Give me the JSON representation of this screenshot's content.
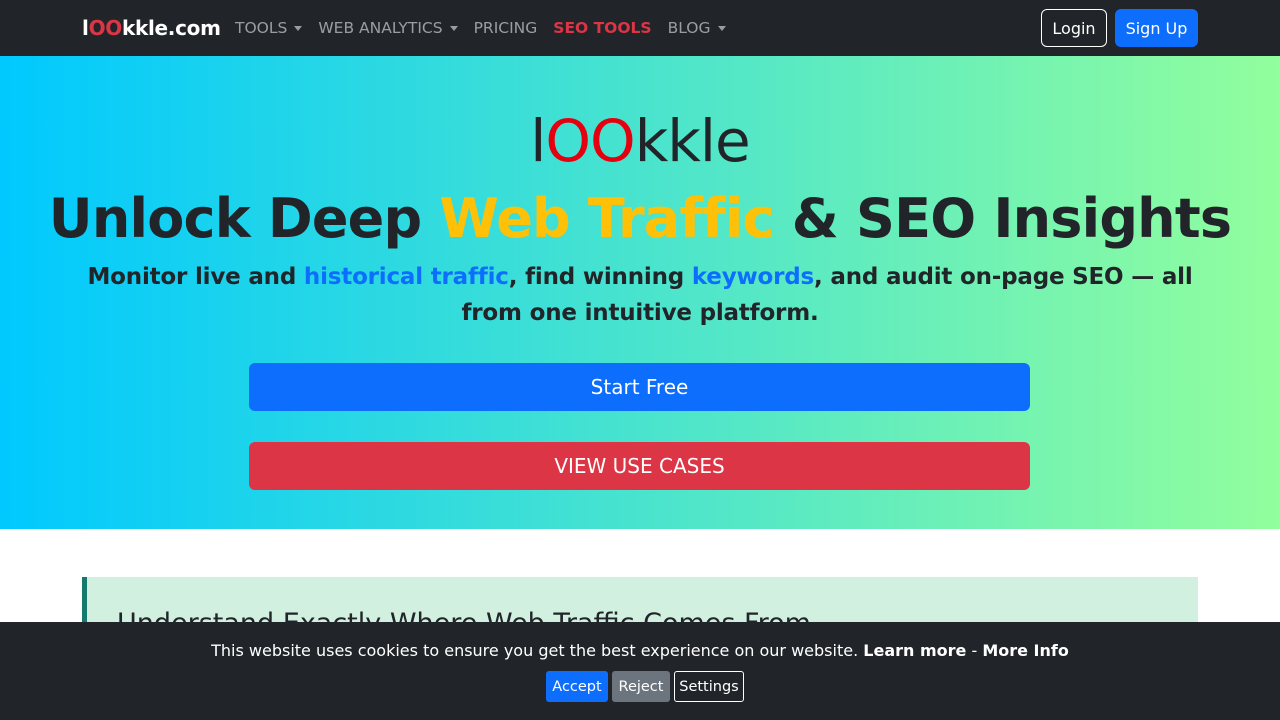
{
  "navbar": {
    "brand": {
      "prefix": "l",
      "highlight": "OO",
      "suffix": "kkle.com"
    },
    "items": [
      {
        "label": "TOOLS",
        "dropdown": true
      },
      {
        "label": "WEB ANALYTICS",
        "dropdown": true
      },
      {
        "label": "PRICING",
        "dropdown": false
      },
      {
        "label": "SEO TOOLS",
        "dropdown": false
      },
      {
        "label": "BLOG",
        "dropdown": true
      }
    ],
    "login_label": "Login",
    "signup_label": "Sign Up"
  },
  "hero": {
    "logo": {
      "prefix": "l",
      "highlight": "OO",
      "suffix": "kkle"
    },
    "headline": {
      "part1": "Unlock Deep ",
      "highlight": "Web Traffic",
      "part2": " & SEO Insights"
    },
    "subtitle": {
      "part1": "Monitor live and ",
      "link1": "historical traffic",
      "part2": ", find winning ",
      "link2": "keywords",
      "part3": ", and audit on-page SEO — all from one intuitive platform."
    },
    "start_label": "Start Free",
    "use_cases_label": "VIEW USE CASES"
  },
  "feature": {
    "title": "Understand Exactly Where Web Traffic Comes From"
  },
  "cookie": {
    "text": "This website uses cookies to ensure you get the best experience on our website.",
    "learn_more": "Learn more",
    "separator": " - ",
    "more_info": "More Info",
    "accept_label": "Accept",
    "reject_label": "Reject",
    "settings_label": "Settings"
  },
  "colors": {
    "navbar_bg": "#212529",
    "brand_red": "#dc3545",
    "primary": "#0d6efd",
    "danger": "#dc3545",
    "warning": "#ffc107",
    "hero_gradient_start": "#00c9ff",
    "hero_gradient_end": "#92fe9d",
    "feature_bg": "#d1f0e0",
    "feature_border": "#157a6e"
  }
}
